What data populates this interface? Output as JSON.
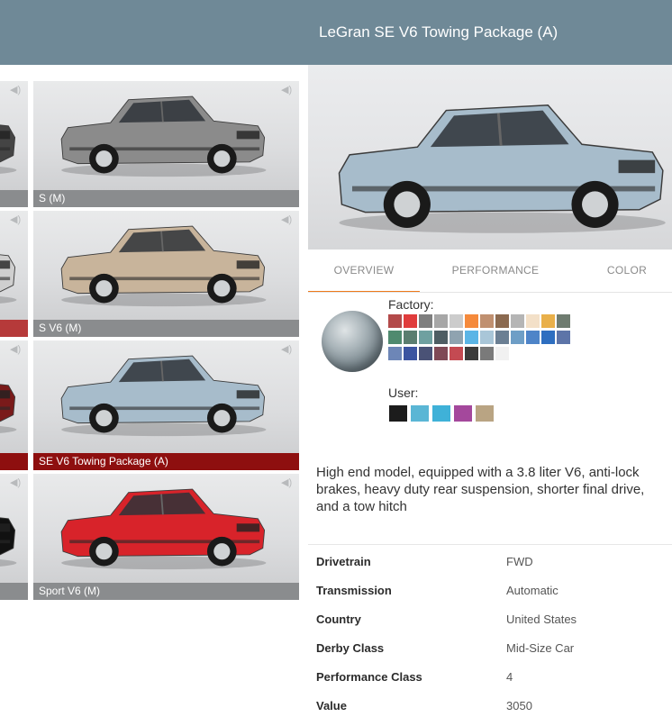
{
  "selected_title": "LeGran SE V6 Towing Package (A)",
  "tiles": [
    {
      "label": "S (M)",
      "paint": "#8b8b8b"
    },
    {
      "label": "S V6 (M)",
      "paint": "#c8b49b"
    },
    {
      "label": "SE V6 Towing Package (A)",
      "paint": "#a7bccb"
    },
    {
      "label": "Sport V6 (M)",
      "paint": "#d8232a"
    }
  ],
  "left_partial_tiles": [
    {
      "paint": "#444444",
      "label_color": "#8a8c8e"
    },
    {
      "paint": "#cfcfcf",
      "label_color": "#b63a3a"
    },
    {
      "paint": "#7a1a1a",
      "label_color": "#8a8c8e"
    },
    {
      "paint": "#111111",
      "label_color": "#8a8c8e"
    }
  ],
  "tabs": [
    "OVERVIEW",
    "PERFORMANCE",
    "COLOR"
  ],
  "paint": {
    "factory_label": "Factory:",
    "user_label": "User:",
    "factory_colors": [
      "#b34a4a",
      "#e03c3c",
      "#7f7f7f",
      "#a7a7a7",
      "#cccccc",
      "#f58a3c",
      "#c09070",
      "#8b6a50",
      "#b5b5b5",
      "#f3e0c8",
      "#e9b04a",
      "#6f7c70",
      "#4f8a6f",
      "#5a7d6f",
      "#6fa0a0",
      "#4e5d63",
      "#8fa3b0",
      "#5bb5e6",
      "#a9c6d8",
      "#6b7f93",
      "#6e9ec6",
      "#4e84c8",
      "#2e6ec0",
      "#5d74a8",
      "#6d86b7",
      "#3b54a0",
      "#4a5276",
      "#7f4956",
      "#c44a52",
      "#3c3c3c",
      "#7a7a7a",
      "#f1f1f1"
    ],
    "user_colors": [
      "#1c1c1c",
      "#5ab6d5",
      "#3fb1d8",
      "#a4489c",
      "#b9a483"
    ]
  },
  "description": "High end model, equipped with a 3.8 liter V6, anti-lock brakes, heavy duty rear suspension, shorter final drive, and a tow hitch",
  "specs": [
    {
      "key": "Drivetrain",
      "value": "FWD"
    },
    {
      "key": "Transmission",
      "value": "Automatic"
    },
    {
      "key": "Country",
      "value": "United States"
    },
    {
      "key": "Derby Class",
      "value": "Mid-Size Car"
    },
    {
      "key": "Performance Class",
      "value": "4"
    },
    {
      "key": "Value",
      "value": "3050"
    }
  ],
  "accent_color": "#ee7a1a",
  "header_color": "#6f8997",
  "selected_border_color": "#a61616"
}
